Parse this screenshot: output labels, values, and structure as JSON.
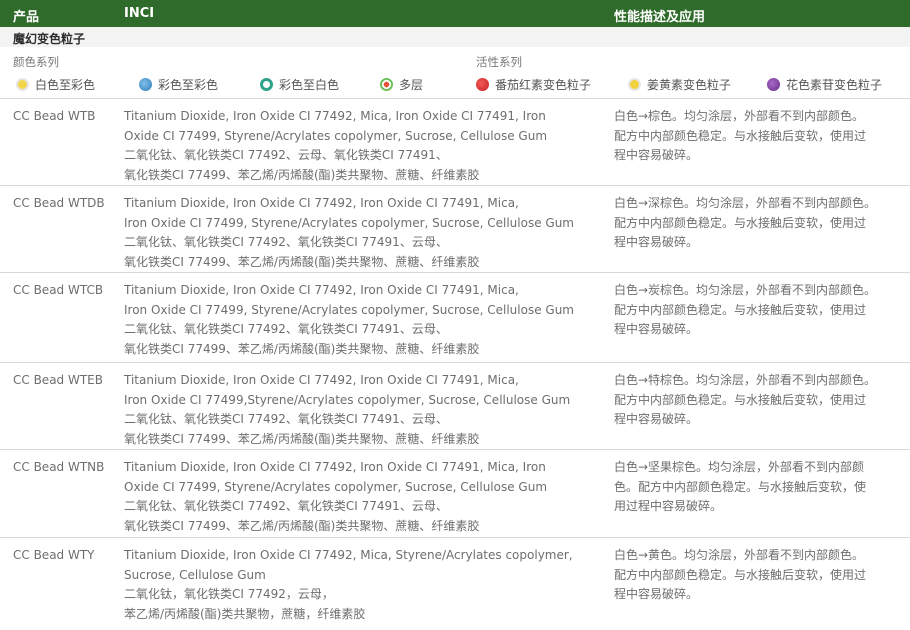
{
  "header": {
    "col_product": "产品",
    "col_inci": "INCI",
    "col_desc": "性能描述及应用"
  },
  "section_title": "魔幻变色粒子",
  "legend": {
    "color_series_title": "颜色系列",
    "active_series_title": "活性系列",
    "items": [
      {
        "label": "白色至彩色",
        "icon": "yellow-dot-icon",
        "color": "#f2d64b"
      },
      {
        "label": "彩色至彩色",
        "icon": "blue-dot-icon",
        "color": "#3f8fc8"
      },
      {
        "label": "彩色至白色",
        "icon": "teal-ring-icon",
        "color": "#2fa38a"
      },
      {
        "label": "多层",
        "icon": "multilayer-dot-icon",
        "color": "#e8533a"
      },
      {
        "label": "番茄红素变色粒子",
        "icon": "red-dot-icon",
        "color": "#d9262b"
      },
      {
        "label": "姜黄素变色粒子",
        "icon": "yellow-dot-icon",
        "color": "#f0d23c"
      },
      {
        "label": "花色素苷变色粒子",
        "icon": "purple-dot-icon",
        "color": "#7a3a9a"
      }
    ]
  },
  "rows": [
    {
      "product": "CC Bead WTB",
      "inci": [
        "Titanium Dioxide, Iron Oxide CI 77492, Mica, Iron Oxide CI 77491, Iron",
        "Oxide CI 77499, Styrene/Acrylates copolymer, Sucrose, Cellulose Gum",
        "二氧化钛、氧化铁类CI 77492、云母、氧化铁类CI 77491、",
        "氧化铁类CI 77499、苯乙烯/丙烯酸(酯)类共聚物、蔗糖、纤维素胶"
      ],
      "desc": [
        "白色→棕色。均匀涂层，外部看不到内部颜色。",
        "配方中内部颜色稳定。与水接触后变软，使用过",
        "程中容易破碎。"
      ]
    },
    {
      "product": "CC Bead WTDB",
      "inci": [
        "Titanium Dioxide, Iron Oxide CI 77492, Iron Oxide CI 77491, Mica,",
        "Iron Oxide CI 77499, Styrene/Acrylates copolymer, Sucrose, Cellulose Gum",
        "二氧化钛、氧化铁类CI 77492、氧化铁类CI 77491、云母、",
        "氧化铁类CI 77499、苯乙烯/丙烯酸(酯)类共聚物、蔗糖、纤维素胶"
      ],
      "desc": [
        "白色→深棕色。均匀涂层，外部看不到内部颜色。",
        "配方中内部颜色稳定。与水接触后变软，使用过",
        "程中容易破碎。"
      ]
    },
    {
      "product": "CC Bead WTCB",
      "inci": [
        "Titanium Dioxide, Iron Oxide CI 77492, Iron Oxide CI 77491, Mica,",
        "Iron Oxide CI 77499, Styrene/Acrylates copolymer, Sucrose, Cellulose Gum",
        "二氧化钛、氧化铁类CI 77492、氧化铁类CI 77491、云母、",
        "氧化铁类CI 77499、苯乙烯/丙烯酸(酯)类共聚物、蔗糖、纤维素胶"
      ],
      "desc": [
        "白色→炭棕色。均匀涂层，外部看不到内部颜色。",
        "配方中内部颜色稳定。与水接触后变软，使用过",
        "程中容易破碎。"
      ]
    },
    {
      "product": "CC Bead WTEB",
      "inci": [
        "Titanium Dioxide, Iron Oxide CI 77492, Iron Oxide CI 77491, Mica,",
        "Iron Oxide CI 77499,Styrene/Acrylates copolymer, Sucrose, Cellulose Gum",
        "二氧化钛、氧化铁类CI 77492、氧化铁类CI 77491、云母、",
        "氧化铁类CI 77499、苯乙烯/丙烯酸(酯)类共聚物、蔗糖、纤维素胶"
      ],
      "desc": [
        "白色→特棕色。均匀涂层，外部看不到内部颜色。",
        "配方中内部颜色稳定。与水接触后变软，使用过",
        "程中容易破碎。"
      ]
    },
    {
      "product": "CC Bead WTNB",
      "inci": [
        "Titanium Dioxide, Iron Oxide CI 77492, Iron Oxide CI 77491, Mica, Iron",
        "Oxide CI 77499, Styrene/Acrylates copolymer, Sucrose, Cellulose Gum",
        "二氧化钛、氧化铁类CI 77492、氧化铁类CI 77491、云母、",
        "氧化铁类CI 77499、苯乙烯/丙烯酸(酯)类共聚物、蔗糖、纤维素胶"
      ],
      "desc": [
        "白色→坚果棕色。均匀涂层，外部看不到内部颜",
        "色。配方中内部颜色稳定。与水接触后变软，使",
        "用过程中容易破碎。"
      ]
    },
    {
      "product": "CC Bead WTY",
      "inci": [
        "Titanium Dioxide, Iron Oxide CI 77492, Mica, Styrene/Acrylates copolymer,",
        " Sucrose, Cellulose Gum",
        "二氧化钛，氧化铁类CI 77492，云母，",
        "苯乙烯/丙烯酸(酯)类共聚物，蔗糖，纤维素胶"
      ],
      "desc": [
        "白色→黄色。均匀涂层，外部看不到内部颜色。",
        "配方中内部颜色稳定。与水接触后变软，使用过",
        "程中容易破碎。"
      ]
    }
  ]
}
